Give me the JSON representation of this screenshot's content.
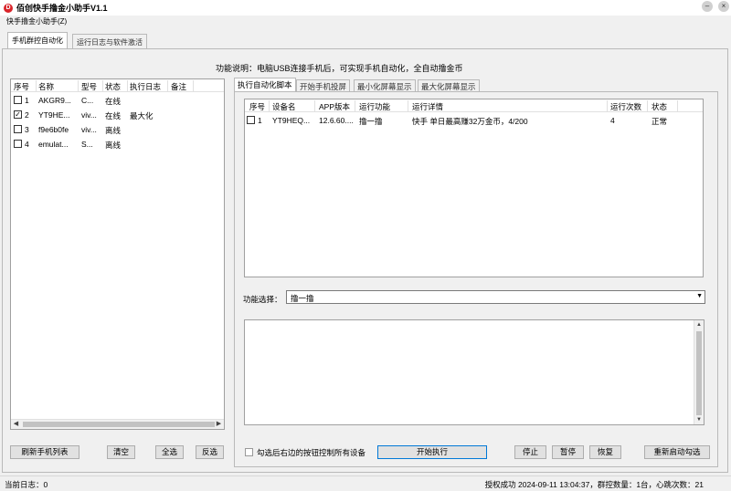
{
  "window": {
    "title": "佰创快手撸金小助手V1.1",
    "icon_letter": "D"
  },
  "menu": {
    "items": [
      "快手撸金小助手(Z)"
    ]
  },
  "main_tabs": [
    {
      "label": "手机群控自动化",
      "active": true
    },
    {
      "label": "运行日志与软件激活",
      "active": false
    }
  ],
  "description": "功能说明：电脑USB连接手机后，可实现手机自动化，全自动撸金币",
  "device_list": {
    "columns": [
      "序号",
      "名称",
      "型号",
      "状态",
      "执行日志",
      "备注"
    ],
    "rows": [
      {
        "checked": false,
        "index": "1",
        "name": "AKGR9...",
        "model": "C...",
        "status": "在线",
        "log": "",
        "note": ""
      },
      {
        "checked": true,
        "index": "2",
        "name": "YT9HE...",
        "model": "viv...",
        "status": "在线",
        "log": "最大化",
        "note": ""
      },
      {
        "checked": false,
        "index": "3",
        "name": "f9e6b0fe",
        "model": "viv...",
        "status": "离线",
        "log": "",
        "note": ""
      },
      {
        "checked": false,
        "index": "4",
        "name": "emulat...",
        "model": "S...",
        "status": "离线",
        "log": "",
        "note": ""
      }
    ]
  },
  "left_buttons": {
    "refresh": "刷新手机列表",
    "clear": "清空",
    "select_all": "全选",
    "invert": "反选"
  },
  "sub_tabs": [
    {
      "label": "执行自动化脚本",
      "active": true
    },
    {
      "label": "开始手机投屏",
      "active": false
    },
    {
      "label": "最小化屏幕显示",
      "active": false
    },
    {
      "label": "最大化屏幕显示",
      "active": false
    }
  ],
  "run_list": {
    "columns": [
      "序号",
      "设备名",
      "APP版本",
      "运行功能",
      "运行详情",
      "运行次数",
      "状态"
    ],
    "rows": [
      {
        "checked": false,
        "index": "1",
        "device": "YT9HEQ...",
        "app_version": "12.6.60....",
        "function": "撸一撸",
        "detail": "快手  单日最高赚32万金币，4/200",
        "count": "4",
        "status": "正常"
      }
    ]
  },
  "function_select": {
    "label": "功能选择：",
    "value": "撸一撸"
  },
  "control_all_label": "勾选后右边的按钮控制所有设备",
  "right_buttons": {
    "start": "开始执行",
    "stop": "停止",
    "pause": "暂停",
    "resume": "恢复",
    "restart_selected": "重新启动勾选"
  },
  "statusbar": {
    "left": "当前日志：0",
    "right": "授权成功  2024-09-11 13:04:37，群控数量：1台，心跳次数：21"
  }
}
